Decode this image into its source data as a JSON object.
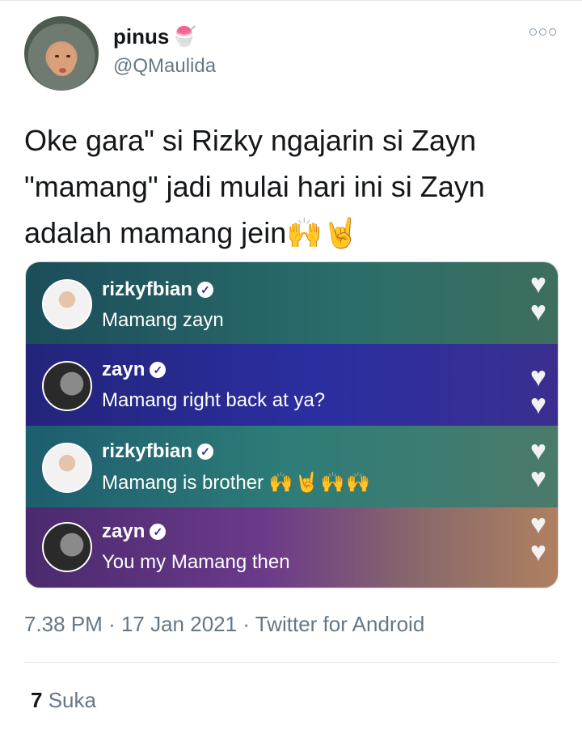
{
  "tweet": {
    "display_name": "pinus",
    "name_emoji": "🍧",
    "handle": "@QMaulida",
    "text": "Oke gara\" si Rizky ngajarin si Zayn \"mamang\" jadi mulai hari ini si Zayn adalah mamang jein🙌🤘",
    "time": "7.38 PM",
    "date": "17 Jan 2021",
    "source": "Twitter for Android",
    "likes_count": "7",
    "likes_label": "Suka"
  },
  "media": {
    "comments": [
      {
        "user": "rizkyfbian",
        "text": "Mamang zayn",
        "verified_icon": "verified-icon"
      },
      {
        "user": "zayn",
        "text": "Mamang right back at ya?",
        "verified_icon": "verified-icon"
      },
      {
        "user": "rizkyfbian",
        "text": "Mamang is brother",
        "emojis": "🙌🤘🙌🙌",
        "verified_icon": "verified-icon"
      },
      {
        "user": "zayn",
        "text": "You my Mamang then",
        "verified_icon": "verified-icon"
      }
    ],
    "heart_glyph": "♥"
  },
  "icons": {
    "more": "more-options-icon",
    "verified": "verified-icon",
    "heart": "heart-icon"
  },
  "colors": {
    "secondary_text": "#657786",
    "primary_text": "#14171a"
  }
}
